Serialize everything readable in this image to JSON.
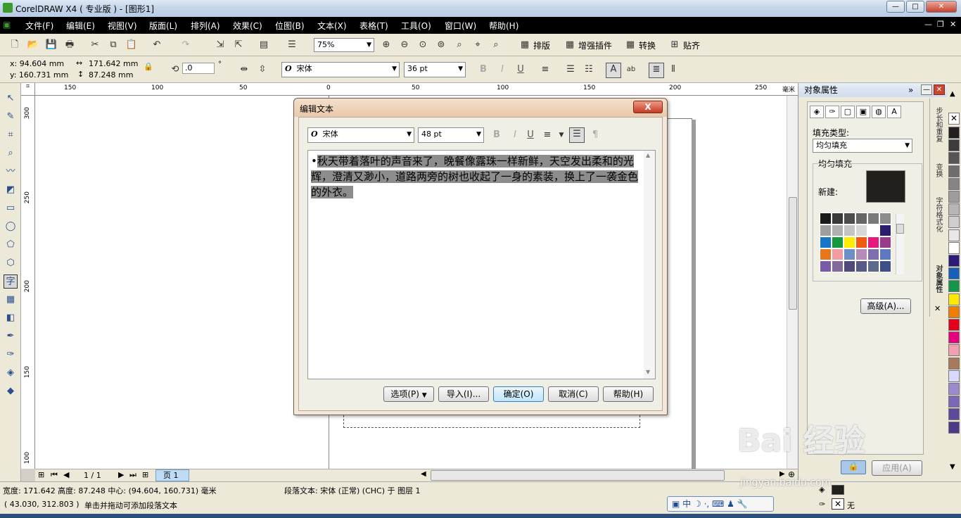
{
  "window": {
    "title": "CorelDRAW X4 ( 专业版 ) - [图形1]",
    "minimize": "—",
    "maximize": "□",
    "close": "✕"
  },
  "menu": [
    "文件(F)",
    "编辑(E)",
    "视图(V)",
    "版面(L)",
    "排列(A)",
    "效果(C)",
    "位图(B)",
    "文本(X)",
    "表格(T)",
    "工具(O)",
    "窗口(W)",
    "帮助(H)"
  ],
  "toolbar1": {
    "zoom": "75%",
    "plugins": [
      "排版",
      "增强插件",
      "转换",
      "贴齐"
    ]
  },
  "propertybar": {
    "x": "x: 94.604 mm",
    "y": "y: 160.731 mm",
    "width": "171.642 mm",
    "height": "87.248 mm",
    "angle": ".0",
    "angle_unit": "°",
    "font": "宋体",
    "size": "36 pt",
    "bold": "B",
    "italic": "I",
    "underline": "U"
  },
  "ruler": {
    "h_labels": [
      "150",
      "100",
      "50",
      "0",
      "50",
      "100",
      "150",
      "200",
      "250"
    ],
    "v_labels": [
      "300",
      "250",
      "200",
      "150",
      "100"
    ],
    "unit": "毫米"
  },
  "pagenav": {
    "count": "1 / 1",
    "tab": "页 1"
  },
  "dialog": {
    "title": "编辑文本",
    "close": "X",
    "font": "宋体",
    "size": "48 pt",
    "text": "秋天带着落叶的声音来了，晚餐像露珠一样新鲜，天空发出柔和的光辉，澄清又渺小，道路两旁的树也收起了一身的素装，换上了一袭金色的外衣。",
    "bullet": "•",
    "buttons": {
      "options": "选项(P)",
      "import": "导入(I)...",
      "ok": "确定(O)",
      "cancel": "取消(C)",
      "help": "帮助(H)"
    }
  },
  "docker": {
    "title": "对象属性",
    "fill_type_label": "填充类型:",
    "fill_type": "均匀填充",
    "group_label": "均匀填充",
    "new_label": "新建:",
    "current_color": "#231f1c",
    "advanced": "高级(A)...",
    "apply": "应用(A)",
    "side_tabs": [
      "步长和重复",
      "变换",
      "字符格式化",
      "对象属性"
    ],
    "swatch_colors": [
      "#1a1a1a",
      "#3a3a3a",
      "#4d4d4d",
      "#666666",
      "#7a7a7a",
      "#8c8c8c",
      "#9e9e9e",
      "#b0b0b0",
      "#c4c4c4",
      "#d8d8d8",
      "#ffffff",
      "#2e1c6e",
      "#1677c8",
      "#149a3c",
      "#ffec00",
      "#f25a0f",
      "#e6197d",
      "#9b3a8a",
      "#e8761a",
      "#f39ca0",
      "#6c8fc8",
      "#b58bb8",
      "#7f6eb0",
      "#5f79c0",
      "#7a5ba8",
      "#826a9a",
      "#4f4a7a",
      "#565a84",
      "#5d6a8c",
      "#3c4f88"
    ]
  },
  "palette": [
    "#231f20",
    "#3c3c3c",
    "#555555",
    "#6d6d6d",
    "#858585",
    "#9d9d9d",
    "#b6b6b6",
    "#cfcfcf",
    "#e8e8e8",
    "#ffffff",
    "#2e1a7a",
    "#1560b8",
    "#14964a",
    "#ffe900",
    "#ef7d00",
    "#e3001b",
    "#e5007e",
    "#f2a0b0",
    "#a77a5a",
    "#d9d9ff",
    "#9b8ad0",
    "#7d68b8",
    "#5d4a9a",
    "#4a3a88"
  ],
  "status": {
    "dims": "宽度: 171.642  高度: 87.248  中心: (94.604, 160.731)  毫米",
    "object": "段落文本: 宋体 (正常) (CHC) 于 图层 1",
    "coords": "( 43.030, 312.803 )",
    "hint": "单击并拖动可添加段落文本",
    "fill_none": "无",
    "ime": "中"
  },
  "watermark": {
    "logo": "Bai 经验",
    "url": "jingyan.baidu.com"
  }
}
